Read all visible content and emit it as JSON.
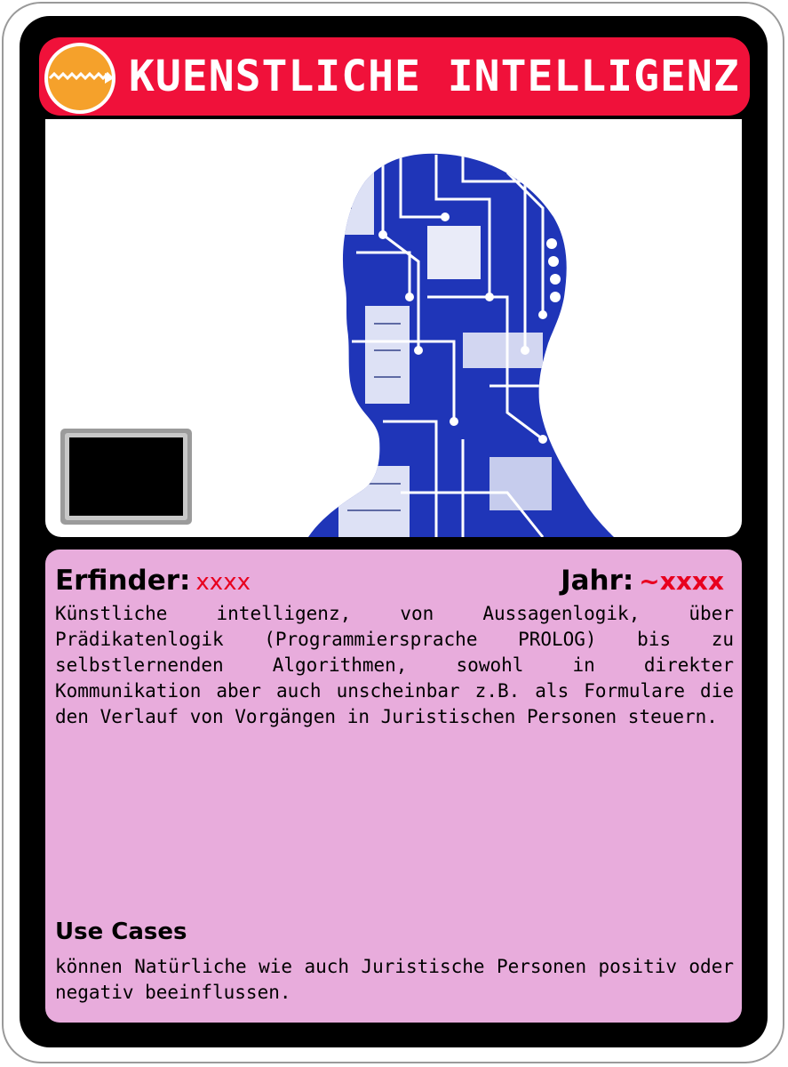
{
  "card": {
    "title": "KUENSTLICHE INTELLIGENZ",
    "logo_icon": "orange-zigzag-badge-icon",
    "image": "circuit-board-human-head-silhouette",
    "chip_icon": "memory-chip-icon",
    "colors": {
      "frame": "#000000",
      "header": "#f0113a",
      "logo": "#f5a12b",
      "panel": "#e8acdc",
      "accent_value": "#e8001e",
      "circuit": "#1a2fae"
    }
  },
  "stats": {
    "inventor_label": "Erfinder:",
    "inventor_value": "xxxx",
    "year_label": "Jahr:",
    "year_value": "~xxxx"
  },
  "description": "Künstliche intelligenz, von Aussagenlogik, über Prädikatenlogik (Programmiersprache PROLOG) bis zu selbstlernenden Algorithmen, sowohl in direkter Kommunikation aber auch unscheinbar z.B. als Formulare die den Verlauf von Vorgängen in Juristischen Personen steuern.",
  "use_cases": {
    "heading": "Use Cases",
    "text": "können Natürliche wie auch Juristische Personen positiv oder negativ beeinflussen."
  }
}
